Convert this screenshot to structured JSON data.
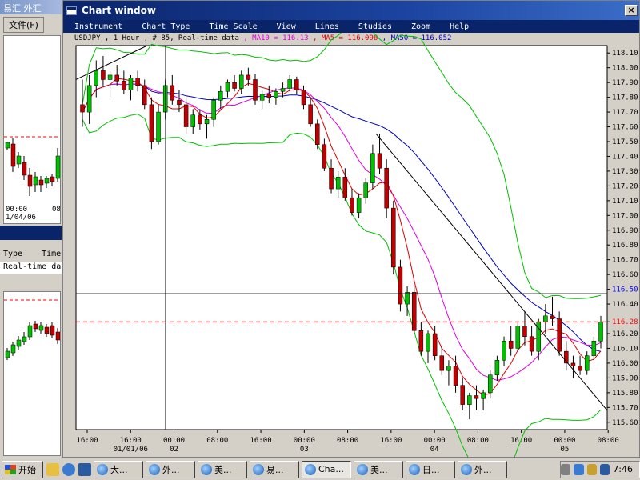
{
  "background_app": {
    "title": "易汇 外汇",
    "menu_label": "文件(F)",
    "panel1_date": "1/04/06",
    "panel1_times": [
      "00:00",
      "08"
    ],
    "table_headers": [
      "Type",
      "Time"
    ],
    "table_row": "Real-time data"
  },
  "window": {
    "title": "Chart window",
    "close_label": "×",
    "menu": [
      "Instrument",
      "Chart Type",
      "Time Scale",
      "View",
      "Lines",
      "Studies",
      "Zoom",
      "Help"
    ]
  },
  "chart_info": {
    "symbol_text": "USDJPY , 1 Hour , # 85, Real-time data",
    "ma10_label": ", MA10 = 116.13",
    "ma5_label": ", MA5 = 116.096",
    "ma50_label": ", MA50 = 116.052",
    "ma10_color": "#e000e0",
    "ma5_color": "#e00000",
    "ma50_color": "#0000c0"
  },
  "chart_data": {
    "type": "candlestick",
    "ylim": [
      115.55,
      118.15
    ],
    "y_ticks": [
      "118.10",
      "118.00",
      "117.90",
      "117.80",
      "117.70",
      "117.60",
      "117.50",
      "117.40",
      "117.30",
      "117.20",
      "117.10",
      "117.00",
      "116.90",
      "116.80",
      "116.70",
      "116.60",
      "116.50",
      "116.40",
      "116.28",
      "116.20",
      "116.10",
      "116.00",
      "115.90",
      "115.80",
      "115.70",
      "115.60"
    ],
    "highlight_ticks": {
      "116.50": "#0000ff",
      "116.28": "#ff0000"
    },
    "horizontal_line": 116.47,
    "dashed_line": 116.28,
    "x_ticks": [
      {
        "label": "16:00",
        "sub": ""
      },
      {
        "label": "16:00",
        "sub": "01/01/06"
      },
      {
        "label": "00:00",
        "sub": "02"
      },
      {
        "label": "08:00",
        "sub": ""
      },
      {
        "label": "16:00",
        "sub": ""
      },
      {
        "label": "00:00",
        "sub": "03"
      },
      {
        "label": "08:00",
        "sub": ""
      },
      {
        "label": "16:00",
        "sub": ""
      },
      {
        "label": "00:00",
        "sub": "04"
      },
      {
        "label": "08:00",
        "sub": ""
      },
      {
        "label": "16:00",
        "sub": ""
      },
      {
        "label": "00:00",
        "sub": "05"
      },
      {
        "label": "08:00",
        "sub": ""
      }
    ],
    "candles": [
      [
        117.75,
        117.92,
        117.6,
        117.7
      ],
      [
        117.7,
        117.95,
        117.62,
        117.88
      ],
      [
        117.88,
        118.05,
        117.8,
        117.98
      ],
      [
        117.98,
        118.08,
        117.88,
        117.92
      ],
      [
        117.92,
        117.98,
        117.8,
        117.95
      ],
      [
        117.95,
        118.02,
        117.88,
        117.91
      ],
      [
        117.91,
        117.98,
        117.82,
        117.85
      ],
      [
        117.85,
        117.95,
        117.78,
        117.93
      ],
      [
        117.93,
        117.98,
        117.84,
        117.88
      ],
      [
        117.88,
        117.92,
        117.72,
        117.75
      ],
      [
        117.75,
        117.8,
        117.45,
        117.5
      ],
      [
        117.5,
        117.75,
        117.48,
        117.7
      ],
      [
        117.7,
        117.92,
        117.65,
        117.88
      ],
      [
        117.88,
        117.95,
        117.75,
        117.78
      ],
      [
        117.78,
        117.85,
        117.7,
        117.75
      ],
      [
        117.75,
        117.8,
        117.55,
        117.6
      ],
      [
        117.6,
        117.72,
        117.55,
        117.68
      ],
      [
        117.68,
        117.72,
        117.58,
        117.62
      ],
      [
        117.62,
        117.68,
        117.52,
        117.65
      ],
      [
        117.65,
        117.8,
        117.6,
        117.78
      ],
      [
        117.78,
        117.88,
        117.72,
        117.84
      ],
      [
        117.84,
        117.92,
        117.8,
        117.9
      ],
      [
        117.9,
        117.95,
        117.84,
        117.86
      ],
      [
        117.86,
        117.98,
        117.82,
        117.95
      ],
      [
        117.95,
        118.0,
        117.88,
        117.92
      ],
      [
        117.92,
        117.96,
        117.75,
        117.78
      ],
      [
        117.78,
        117.85,
        117.72,
        117.82
      ],
      [
        117.82,
        117.88,
        117.76,
        117.8
      ],
      [
        117.8,
        117.86,
        117.75,
        117.84
      ],
      [
        117.84,
        117.9,
        117.8,
        117.86
      ],
      [
        117.86,
        117.95,
        117.84,
        117.92
      ],
      [
        117.92,
        117.94,
        117.82,
        117.85
      ],
      [
        117.85,
        117.88,
        117.72,
        117.75
      ],
      [
        117.75,
        117.8,
        117.6,
        117.62
      ],
      [
        117.62,
        117.65,
        117.45,
        117.48
      ],
      [
        117.48,
        117.52,
        117.3,
        117.32
      ],
      [
        117.32,
        117.38,
        117.15,
        117.18
      ],
      [
        117.18,
        117.3,
        117.12,
        117.26
      ],
      [
        117.26,
        117.32,
        117.1,
        117.12
      ],
      [
        117.12,
        117.18,
        117.0,
        117.02
      ],
      [
        117.02,
        117.15,
        116.98,
        117.12
      ],
      [
        117.12,
        117.25,
        117.08,
        117.22
      ],
      [
        117.22,
        117.48,
        117.18,
        117.42
      ],
      [
        117.42,
        117.55,
        117.28,
        117.32
      ],
      [
        117.32,
        117.38,
        116.98,
        117.05
      ],
      [
        117.05,
        117.1,
        116.6,
        116.65
      ],
      [
        116.65,
        116.7,
        116.35,
        116.4
      ],
      [
        116.4,
        116.52,
        116.32,
        116.48
      ],
      [
        116.48,
        116.52,
        116.2,
        116.22
      ],
      [
        116.22,
        116.28,
        116.05,
        116.08
      ],
      [
        116.08,
        116.22,
        116.0,
        116.2
      ],
      [
        116.2,
        116.25,
        116.02,
        116.05
      ],
      [
        116.05,
        116.12,
        115.92,
        115.95
      ],
      [
        115.95,
        116.02,
        115.85,
        115.98
      ],
      [
        115.98,
        116.05,
        115.8,
        115.85
      ],
      [
        115.85,
        115.9,
        115.68,
        115.72
      ],
      [
        115.72,
        115.8,
        115.62,
        115.78
      ],
      [
        115.78,
        115.85,
        115.68,
        115.76
      ],
      [
        115.76,
        115.82,
        115.68,
        115.8
      ],
      [
        115.8,
        115.95,
        115.76,
        115.92
      ],
      [
        115.92,
        116.05,
        115.88,
        116.02
      ],
      [
        116.02,
        116.18,
        115.98,
        116.15
      ],
      [
        116.15,
        116.25,
        116.05,
        116.1
      ],
      [
        116.1,
        116.28,
        116.08,
        116.25
      ],
      [
        116.25,
        116.35,
        116.12,
        116.18
      ],
      [
        116.18,
        116.25,
        116.05,
        116.08
      ],
      [
        116.08,
        116.3,
        116.02,
        116.28
      ],
      [
        116.28,
        116.4,
        116.2,
        116.32
      ],
      [
        116.32,
        116.45,
        116.25,
        116.3
      ],
      [
        116.3,
        116.35,
        116.05,
        116.08
      ],
      [
        116.08,
        116.15,
        115.95,
        116.0
      ],
      [
        116.0,
        116.05,
        115.9,
        115.98
      ],
      [
        115.98,
        116.05,
        115.92,
        115.95
      ],
      [
        115.95,
        116.08,
        115.92,
        116.05
      ],
      [
        116.05,
        116.18,
        116.02,
        116.15
      ],
      [
        116.15,
        116.32,
        116.1,
        116.28
      ]
    ],
    "series_colors": {
      "up": "#00c000",
      "down": "#c00000",
      "bollinger": "#00c000"
    }
  },
  "taskbar": {
    "start_label": "开始",
    "tasks": [
      "大...",
      "外...",
      "美...",
      "易...",
      "Cha...",
      "美...",
      "日...",
      "外..."
    ],
    "active_task_index": 4,
    "clock": "7:46"
  }
}
